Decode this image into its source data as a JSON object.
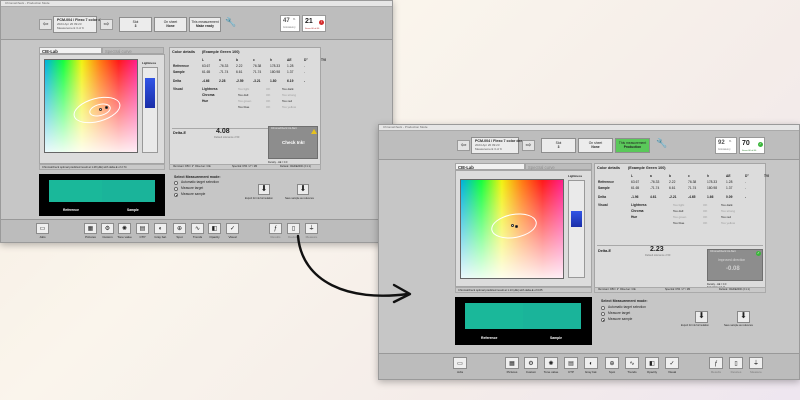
{
  "window_title": "ChromaCheck - Production Mode",
  "job": {
    "name": "PCM-004 / Flexo 7 color dem",
    "date": "2024 Apr 20 09:23",
    "measurement": "Measurement 3 of 9"
  },
  "toolbar": {
    "slot_label": "Slot",
    "slot_value": "3",
    "onsheet_label": "On sheet",
    "onsheet_value": "None"
  },
  "window1": {
    "mode_line1": "This measurement",
    "mode_line2": "Make ready",
    "score": "47",
    "score_sub": "Consistency",
    "kpi_value": "21",
    "kpi_sub": "Score 60 of 60"
  },
  "window2": {
    "mode_line1": "This measurement",
    "mode_line2": "Production",
    "score": "92",
    "score_sub": "Consistency",
    "kpi_value": "70",
    "kpi_sub": "Score 60 of 60"
  },
  "cielab": {
    "tab_active": "CIE-Lab",
    "tab_inactive": "Spectral curve",
    "lightness_label": "Lightness"
  },
  "color_details": {
    "header": "Color details",
    "swatch_name": "(Example Green 100)",
    "columns": [
      "L",
      "a",
      "b",
      "c",
      "h",
      "ΔE",
      "D°",
      "TVI"
    ],
    "rows": [
      {
        "name": "Reference",
        "values": [
          "63.67",
          "-76.33",
          "2.22",
          "76.38",
          "178.33",
          "1.28",
          "-",
          ""
        ]
      },
      {
        "name": "Sample",
        "values": [
          "61.65",
          "-71.74",
          "6.61",
          "71.74",
          "180.98",
          "1.37",
          "-",
          ""
        ]
      }
    ],
    "delta_w1": {
      "name": "Delta",
      "values": [
        "-4.66",
        "2.28",
        "-2.59",
        "-3.21",
        "1.80",
        "6.19",
        "-",
        ""
      ]
    },
    "delta_w2": {
      "name": "Delta",
      "values": [
        "-1.96",
        "4.61",
        "-2.21",
        "-4.65",
        "1.66",
        "0.09",
        "-",
        ""
      ]
    },
    "visual_label": "Visual",
    "visual_rows": [
      {
        "name": "Lightness",
        "left": "Too light",
        "mid": "OK",
        "right": "Too dark"
      },
      {
        "name": "Chroma",
        "left": "Too dull",
        "mid": "OK",
        "right": "Too strong"
      },
      {
        "name": "Hue",
        "left": "Too green",
        "mid": "OK",
        "right": "Too red"
      },
      {
        "name": "",
        "left": "Too blue",
        "mid": "OK",
        "right": "Too yellow"
      }
    ],
    "visual_active_w1": [
      "Too dark",
      "Too dull",
      "Too red",
      "Too blue"
    ],
    "visual_active_w2": [
      "Too dark",
      "Too dull",
      "Too red",
      "Too blue"
    ]
  },
  "delta_e": {
    "label": "Delta-E",
    "value_w1": "4.08",
    "value_w2": "2.23",
    "sub": "Default tolerance 2.50",
    "check_label": "Check Ink!",
    "check_title": "ChromaCheck Ink Alert",
    "improve_label": "Improved direction",
    "improve_value": "-0.08",
    "w1_detail": "Density - ΔE = 0.0\nSaturation = 0.11",
    "w2_detail": "Density - ΔE = 0.0\nSaturation = 0.11"
  },
  "footer_info": {
    "illuminant": "Illuminant: D50 / 2° Observer: CIE",
    "spectral": "Spectral: D50 / 2° / M0",
    "delta_w1": "Delta-E: CIEDE2000 (2:1:1)",
    "delta_w2": "Delta-E: CIEDE2000 (2:1:1)"
  },
  "chromacheck": {
    "text_w1": "ChromaCheck optimal predicted result at 1.28 (ΔE) with delta-E of 2.74",
    "text_w2": "ChromaCheck optimal predicted result at 1.13 (ΔE) with delta-E of 0.65"
  },
  "swatch": {
    "reference": "Reference",
    "sample": "Sample"
  },
  "measurement_mode": {
    "title": "Select Measurement mode:",
    "options": [
      "Automatic target selection",
      "Measure target",
      "Measure sample"
    ],
    "selected_index": 2
  },
  "actions": {
    "export_label": "Export for ink formulation",
    "save_label": "Save sample as reference"
  },
  "bottom_tools": [
    {
      "label": "Jobs",
      "icon": "jobs-icon"
    },
    {
      "label": "Pictures",
      "icon": "pictures-icon"
    },
    {
      "label": "Custom",
      "icon": "custom-icon"
    },
    {
      "label": "Tone value",
      "icon": "tone-value-icon"
    },
    {
      "label": "CTP",
      "icon": "ctp-icon"
    },
    {
      "label": "Gray bal.",
      "icon": "gray-balance-icon"
    },
    {
      "label": "Spot",
      "icon": "spot-icon"
    },
    {
      "label": "Trends",
      "icon": "trends-icon"
    },
    {
      "label": "Opacity",
      "icon": "opacity-icon"
    },
    {
      "label": "Visual",
      "icon": "visual-icon"
    },
    {
      "label": "Results",
      "icon": "results-icon"
    },
    {
      "label": "Devices",
      "icon": "devices-icon"
    },
    {
      "label": "Measure",
      "icon": "measure-icon"
    }
  ],
  "colors": {
    "swatch_green": "#1ab89a",
    "ok_green": "#3ab53a",
    "alert_red": "#d42b2b",
    "warning_yellow": "#e7c21d",
    "lightness_blue": "#3255e6"
  }
}
